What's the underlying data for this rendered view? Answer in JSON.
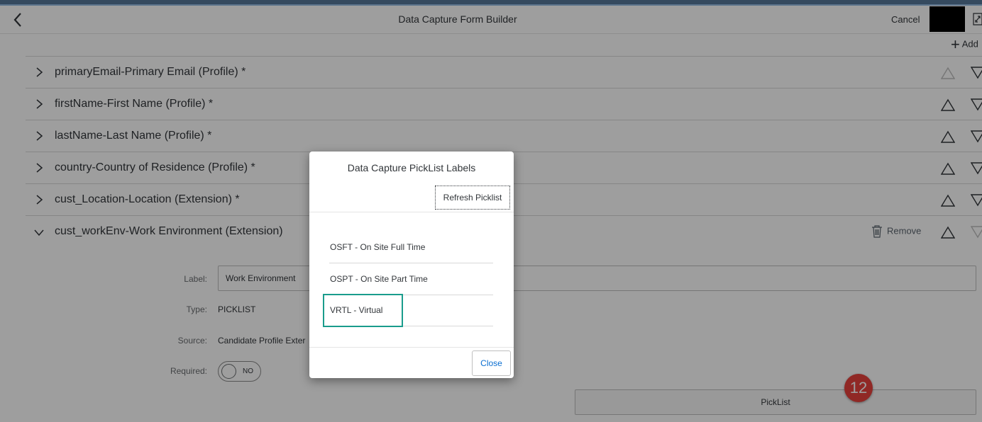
{
  "header": {
    "title": "Data Capture Form Builder",
    "cancel_label": "Cancel"
  },
  "toolbar": {
    "add_label": "Add"
  },
  "fields": [
    {
      "label": "primaryEmail-Primary Email (Profile)  *",
      "expanded": false
    },
    {
      "label": "firstName-First Name (Profile)  *",
      "expanded": false
    },
    {
      "label": "lastName-Last Name (Profile)  *",
      "expanded": false
    },
    {
      "label": "country-Country of Residence (Profile)  *",
      "expanded": false
    },
    {
      "label": "cust_Location-Location (Extension)  *",
      "expanded": false
    },
    {
      "label": "cust_workEnv-Work Environment (Extension)",
      "expanded": true,
      "remove_label": "Remove"
    }
  ],
  "detail": {
    "label_caption": "Label:",
    "label_value": "Work Environment",
    "type_caption": "Type:",
    "type_value": "PICKLIST",
    "source_caption": "Source:",
    "source_value": "Candidate Profile Exter",
    "required_caption": "Required:",
    "required_value": "NO",
    "picklist_button": "PickList"
  },
  "step_badge": "12",
  "dialog": {
    "title": "Data Capture PickList Labels",
    "refresh_label": "Refresh Picklist",
    "options": [
      "OSFT - On Site Full Time",
      "OSPT - On Site Part Time",
      "VRTL - Virtual"
    ],
    "highlighted_option": "VRTL - Virtual",
    "close_label": "Close"
  },
  "colors": {
    "shell_bar": "#354a5f",
    "highlight": "#1a9c8c",
    "badge": "#e8423d",
    "link": "#0a6ed1"
  }
}
